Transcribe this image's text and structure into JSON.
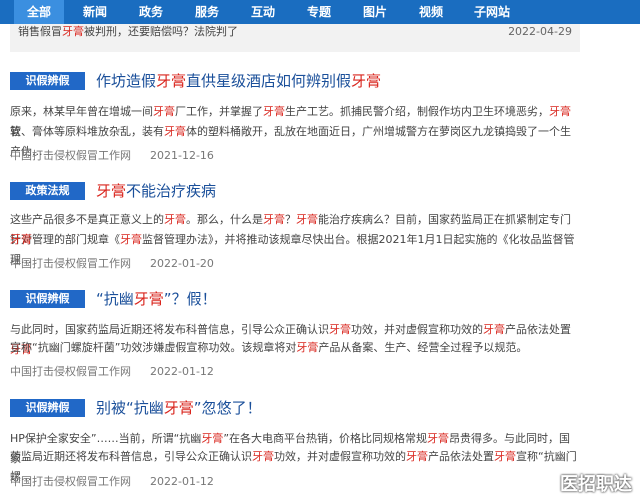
{
  "nav": {
    "items": [
      "全部",
      "新闻",
      "政务",
      "服务",
      "互动",
      "专题",
      "图片",
      "视频",
      "子网站"
    ],
    "active_index": 0
  },
  "top_snippet": {
    "text_parts": [
      "销售假冒",
      "牙膏",
      "被判刑，还要赔偿吗？法院判了"
    ],
    "date": "2022-04-29"
  },
  "articles": [
    {
      "badge": "识假辨假",
      "title_parts": [
        "作坊造假",
        "牙膏",
        "直供星级酒店如何辨别假",
        "牙膏"
      ],
      "body_line1": [
        "原来，林某早年曾在增城一间",
        "牙膏",
        "厂工作，并掌握了",
        "牙膏",
        "生产工艺。抓捕民警介绍，制假作坊内卫生环境恶劣，",
        "牙膏",
        "软"
      ],
      "body_line2": [
        "管、膏体等原料堆放杂乱，装有",
        "牙膏",
        "体的塑料桶敞开，乱放在地面近日，广州增城警方在萝岗区九龙镇捣毁了一个生产伪..."
      ],
      "source": "中国打击侵权假冒工作网",
      "date": "2021-12-16"
    },
    {
      "badge": "政策法规",
      "title_parts": [
        "",
        "牙膏",
        "不能治疗疾病"
      ],
      "body_line1": [
        "这些产品很多不是真正意义上的",
        "牙膏",
        "。那么，什么是",
        "牙膏",
        "？",
        "牙膏",
        "能治疗疾病么？目前，国家药监局正在抓紧制定专门针对"
      ],
      "body_line2": [
        "",
        "牙膏",
        "管理的部门规章《",
        "牙膏",
        "监督管理办法》，并将推动该规章尽快出台。根据2021年1月1日起实施的《化妆品监督管理..."
      ],
      "source": "中国打击侵权假冒工作网",
      "date": "2022-01-20"
    },
    {
      "badge": "识假辨假",
      "title_parts": [
        "“抗幽",
        "牙膏",
        "”？假！"
      ],
      "body_line1": [
        "与此同时，国家药监局近期还将发布科普信息，引导公众正确认识",
        "牙膏",
        "功效，并对虚假宣称功效的",
        "牙膏",
        "产品依法处置",
        "牙膏"
      ],
      "body_line2": [
        "宣称“抗幽门螺旋杆菌”功效涉嫌虚假宣称功效。该规章将对",
        "牙膏",
        "产品从备案、生产、经营全过程予以规范。"
      ],
      "source": "中国打击侵权假冒工作网",
      "date": "2022-01-12"
    },
    {
      "badge": "识假辨假",
      "title_parts": [
        "别被“抗幽",
        "牙膏",
        "”忽悠了！"
      ],
      "body_line1": [
        "HP保护全家安全”……当前，所谓“抗幽",
        "牙膏",
        "”在各大电商平台热销，价格比同规格常规",
        "牙膏",
        "昂贵得多。与此同时，国家"
      ],
      "body_line2": [
        "药监局近期还将发布科普信息，引导公众正确认识",
        "牙膏",
        "功效，并对虚假宣称功效的",
        "牙膏",
        "产品依法处置",
        "牙膏",
        "宣称“抗幽门螺..."
      ],
      "source": "中国打击侵权假冒工作网",
      "date": "2022-01-12"
    }
  ],
  "watermark": "医招职达",
  "colors": {
    "nav_bg": "#1a6dc0",
    "badge_bg": "#2168c7",
    "title": "#1a4f9a",
    "highlight": "#d9251d"
  }
}
